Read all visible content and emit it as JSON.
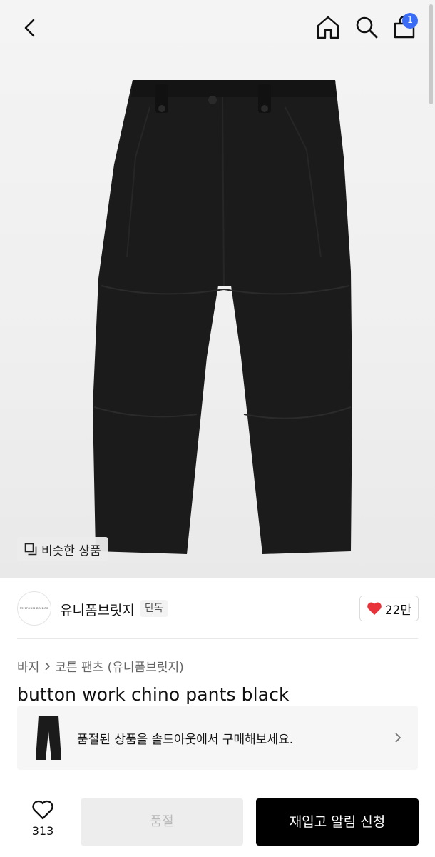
{
  "header": {
    "back_icon": "chevron-left-icon",
    "home_icon": "home-icon",
    "search_icon": "search-icon",
    "bag_icon": "shopping-bag-icon",
    "bag_count": "1",
    "badge_color": "#3b6cf6"
  },
  "hero": {
    "similar_label": "비슷한 상품"
  },
  "brand": {
    "logo_text": "UNIFORM BRIDGE",
    "name": "유니폼브릿지",
    "tag": "단독",
    "likes": "22만",
    "heart_color": "#e8333a"
  },
  "breadcrumb": {
    "category": "바지",
    "subcategory": "코튼 팬츠 (유니폼브릿지)"
  },
  "product": {
    "title": "button work chino pants black"
  },
  "soldout_notice": {
    "text": "품절된 상품을 솔드아웃에서 구매해보세요."
  },
  "bottom": {
    "wish_count": "313",
    "soldout_label": "품절",
    "restock_label": "재입고 알림 신청"
  }
}
